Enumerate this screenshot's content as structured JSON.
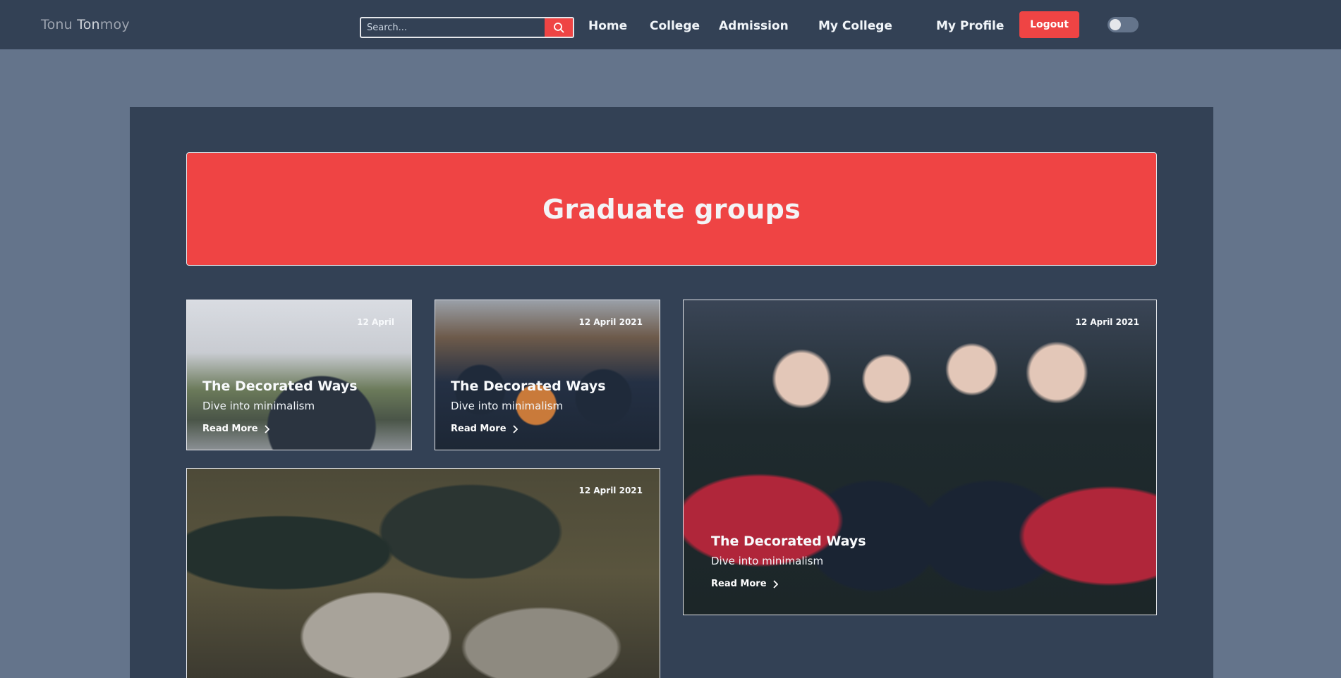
{
  "navbar": {
    "brand_part1": "Tonu ",
    "brand_part2": "Ton",
    "brand_part3": "moy",
    "search_placeholder": "Search...",
    "links": [
      "Home",
      "College",
      "Admission",
      "My College",
      "My Profile"
    ],
    "logout_label": "Logout",
    "theme_toggle": "off"
  },
  "hero": {
    "title": "Graduate groups"
  },
  "cards": [
    {
      "date": "12 April",
      "title": "The Decorated Ways",
      "subtitle": "Dive into minimalism",
      "read_more": "Read More"
    },
    {
      "date": "12 April 2021",
      "title": "The Decorated Ways",
      "subtitle": "Dive into minimalism",
      "read_more": "Read More"
    },
    {
      "date": "12 April 2021",
      "title": "The Decorated Ways",
      "subtitle": "Dive into minimalism",
      "read_more": "Read More"
    },
    {
      "date": "12 April 2021"
    }
  ],
  "colors": {
    "accent": "#ef4444",
    "navbar": "#334155",
    "page": "#64748b",
    "panel": "#334155"
  }
}
